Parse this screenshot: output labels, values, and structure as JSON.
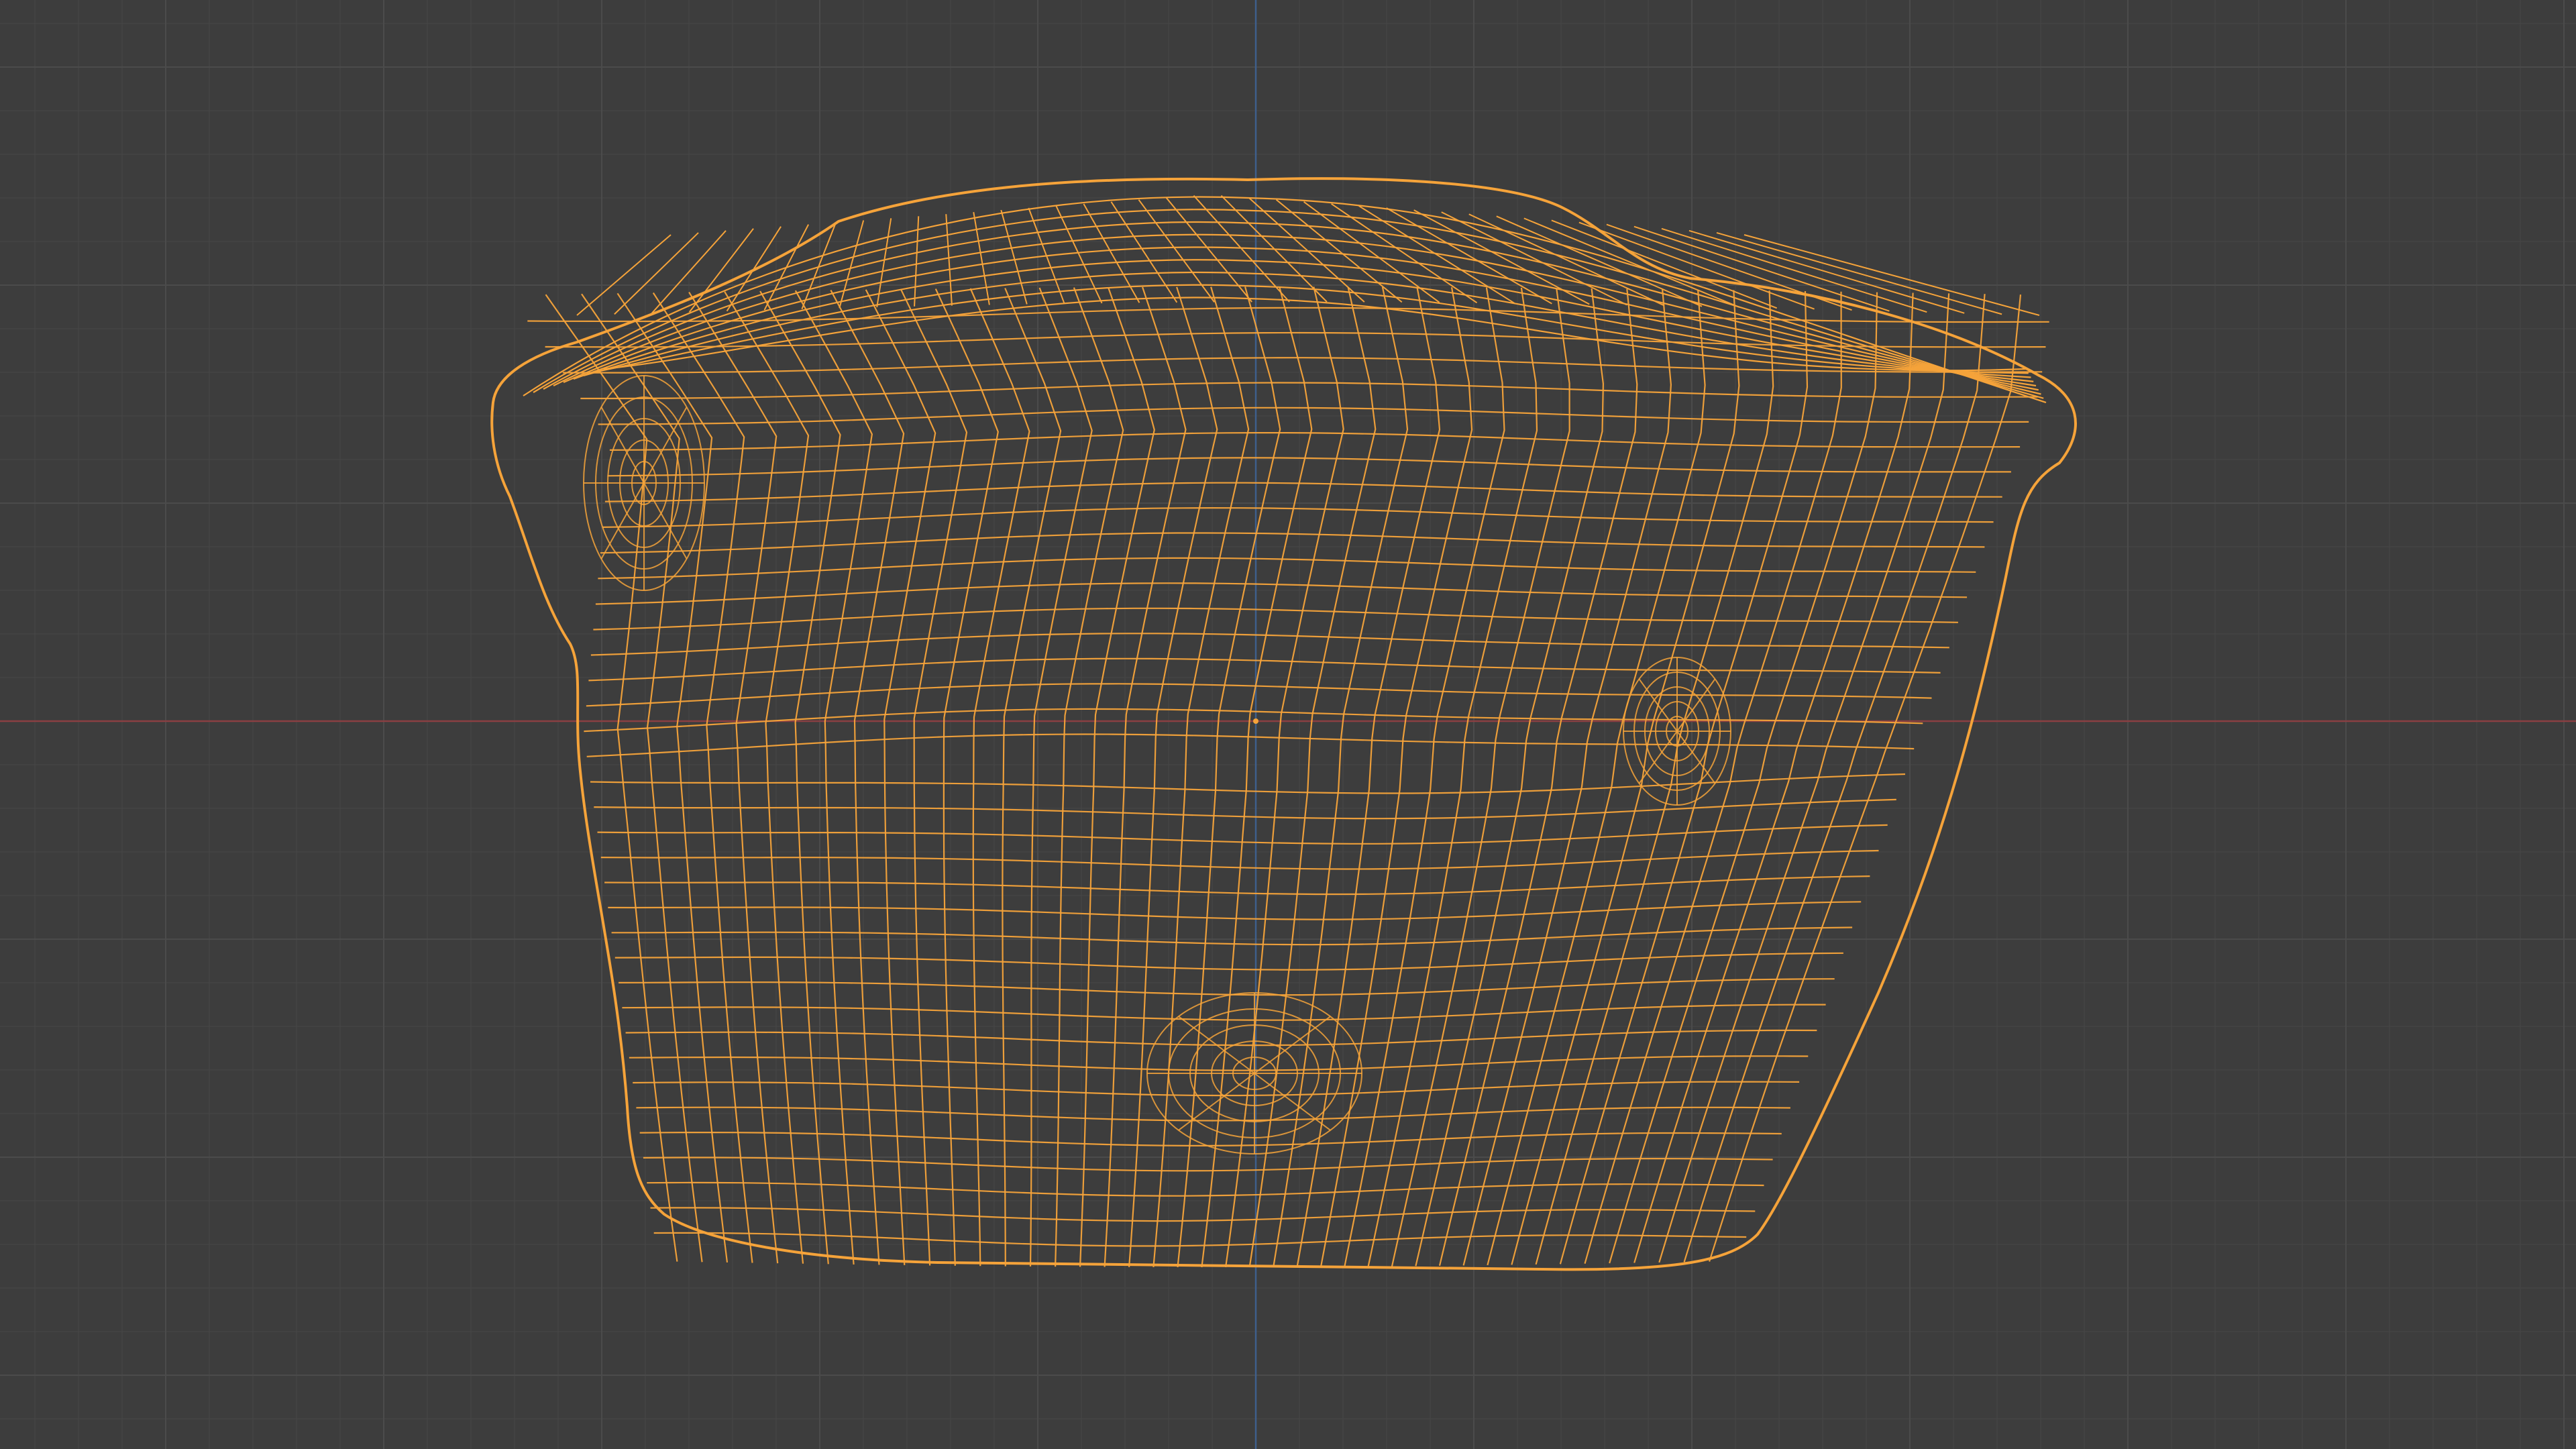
{
  "viewport": {
    "background_color": "#3d3d3d",
    "grid_minor_color": "#454545",
    "grid_major_color": "#4b4b4b",
    "axis_x_color": "#8a3f42",
    "axis_z_color": "#3e5f8c",
    "selected_wire_color": "#f5a33a",
    "grid_visible": true,
    "mode": "wireframe",
    "selected_object": {
      "name": "",
      "icon": "mesh-object-icon",
      "state": "selected"
    },
    "origin_marker_color": "#f5a33a"
  }
}
